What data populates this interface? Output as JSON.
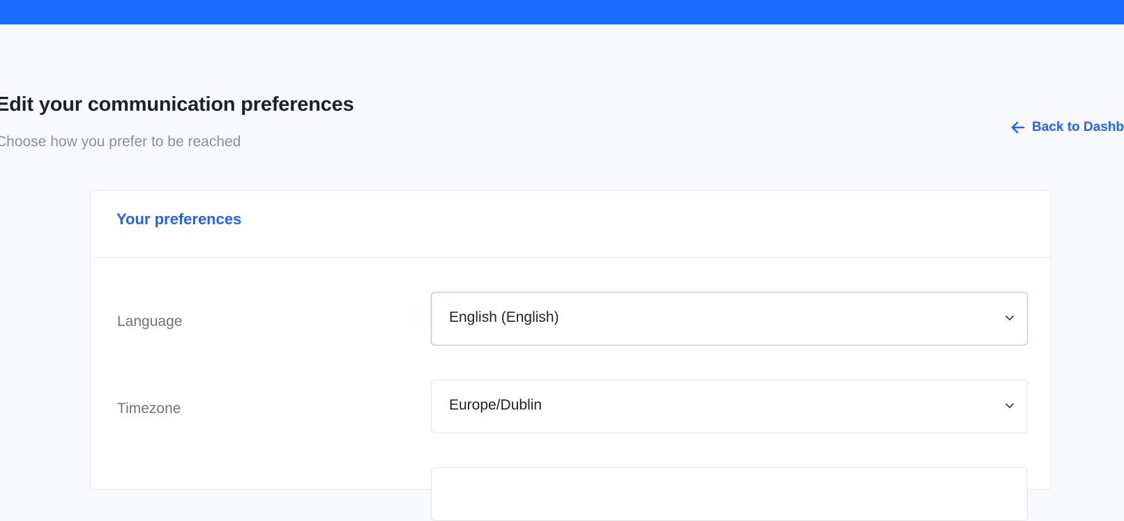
{
  "header": {
    "title": "Edit your communication preferences",
    "subtitle": "Choose how you prefer to be reached",
    "back_link": "Back to Dashboard"
  },
  "card": {
    "title": "Your preferences",
    "fields": [
      {
        "label": "Language",
        "value": "English (English)"
      },
      {
        "label": "Timezone",
        "value": "Europe/Dublin"
      },
      {
        "label": "",
        "value": ""
      }
    ]
  },
  "icons": {
    "back": "arrow-left-icon",
    "select": "chevron-down-icon"
  },
  "colors": {
    "topbar": "#1c6bff",
    "accent": "#2563eb",
    "background": "#f7f9fc"
  }
}
